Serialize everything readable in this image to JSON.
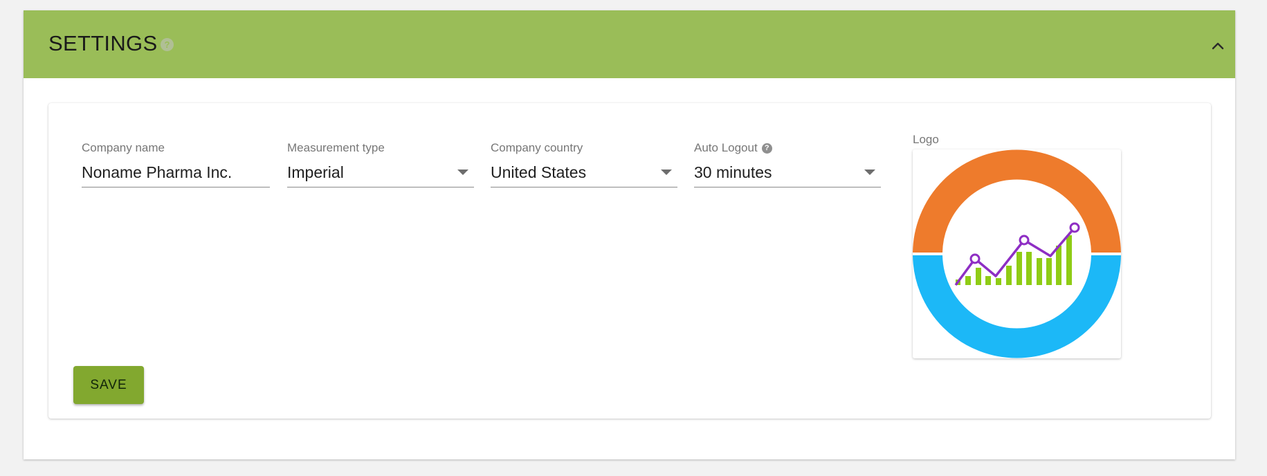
{
  "panel": {
    "title": "SETTINGS",
    "help_icon": "question-circle-icon",
    "collapse_icon": "chevron-up-icon",
    "header_color": "#9abd58"
  },
  "form": {
    "company_name": {
      "label": "Company name",
      "value": "Noname Pharma Inc."
    },
    "measurement_type": {
      "label": "Measurement type",
      "value": "Imperial"
    },
    "company_country": {
      "label": "Company country",
      "value": "United States"
    },
    "auto_logout": {
      "label": "Auto Logout",
      "value": "30 minutes",
      "help_icon": "question-circle-icon"
    },
    "logo": {
      "label": "Logo",
      "colors": {
        "top_ring": "#ee7b2c",
        "bottom_ring": "#1cb8f7",
        "bars": "#8fcc15",
        "line": "#8e2ec4"
      }
    }
  },
  "actions": {
    "save_label": "SAVE",
    "save_color": "#82a82f"
  }
}
